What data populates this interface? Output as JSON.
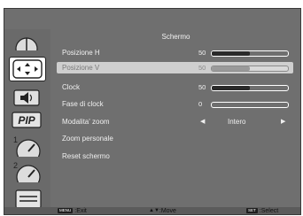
{
  "menu": {
    "title": "Schermo",
    "items": [
      {
        "label": "Posizione H",
        "value": "50",
        "slider": 0.5
      },
      {
        "label": "Posizione V",
        "value": "50",
        "slider": 0.5
      },
      {
        "label": "Clock",
        "value": "50",
        "slider": 0.5
      },
      {
        "label": "Fase di clock",
        "value": "0",
        "slider": 0.0
      },
      {
        "label": "Modalita' zoom",
        "value": "Intero"
      },
      {
        "label": "Zoom personale"
      },
      {
        "label": "Reset schermo"
      }
    ],
    "selected_index": 1
  },
  "sidebar": {
    "icons": [
      "picture-icon",
      "screen-position-icon",
      "audio-icon",
      "pip-icon",
      "configuration1-icon",
      "configuration2-icon",
      "advanced-option-icon"
    ],
    "pip_label": "PIP",
    "active_index": 1
  },
  "footer": {
    "exit_key": "MENU",
    "exit_label": ":Exit",
    "move_label": ":Move",
    "select_key": "SET",
    "select_label": ":Select"
  },
  "colors": {
    "panel": "#6f6f6f",
    "selected_row": "#cfcfcf",
    "footer": "#5b5b5b"
  }
}
